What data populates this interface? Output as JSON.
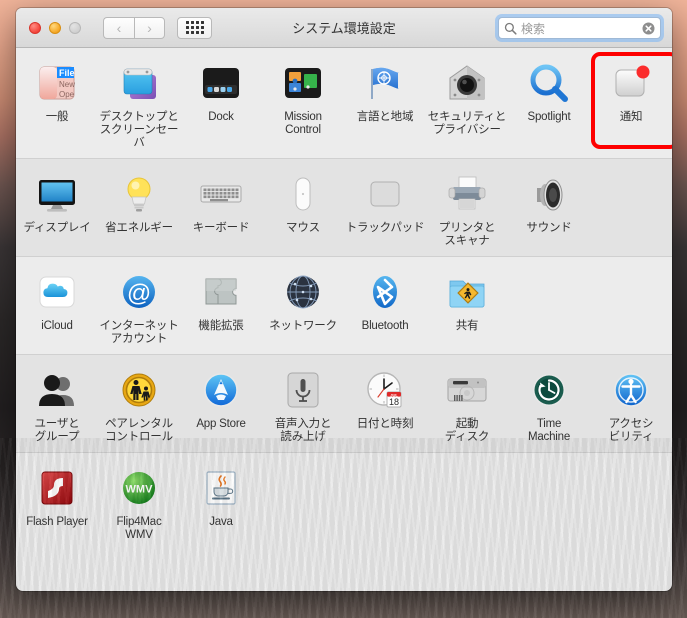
{
  "window": {
    "title": "システム環境設定",
    "traffic_lights": [
      "close",
      "minimize",
      "zoom"
    ],
    "nav": {
      "back": "‹",
      "forward": "›"
    },
    "grid_button": "show-all-grid-button"
  },
  "search": {
    "placeholder": "検索",
    "value": "検索",
    "icon": "search-icon",
    "clear_icon": "clear-icon"
  },
  "highlight": {
    "target": "通知",
    "color": "#fe0000"
  },
  "rows": [
    {
      "shade": "a",
      "items": [
        {
          "label": "一般",
          "icon": "general-icon"
        },
        {
          "label": "デスクトップと\nスクリーンセーバ",
          "icon": "desktop-screensaver-icon"
        },
        {
          "label": "Dock",
          "icon": "dock-icon"
        },
        {
          "label": "Mission\nControl",
          "icon": "mission-control-icon"
        },
        {
          "label": "言語と地域",
          "icon": "language-region-icon"
        },
        {
          "label": "セキュリティと\nプライバシー",
          "icon": "security-privacy-icon"
        },
        {
          "label": "Spotlight",
          "icon": "spotlight-icon"
        },
        {
          "label": "通知",
          "icon": "notifications-icon",
          "highlighted": true
        }
      ]
    },
    {
      "shade": "b",
      "items": [
        {
          "label": "ディスプレイ",
          "icon": "displays-icon"
        },
        {
          "label": "省エネルギー",
          "icon": "energy-saver-icon"
        },
        {
          "label": "キーボード",
          "icon": "keyboard-icon"
        },
        {
          "label": "マウス",
          "icon": "mouse-icon"
        },
        {
          "label": "トラックパッド",
          "icon": "trackpad-icon"
        },
        {
          "label": "プリンタと\nスキャナ",
          "icon": "printers-scanners-icon"
        },
        {
          "label": "サウンド",
          "icon": "sound-icon"
        }
      ]
    },
    {
      "shade": "a",
      "items": [
        {
          "label": "iCloud",
          "icon": "icloud-icon"
        },
        {
          "label": "インターネット\nアカウント",
          "icon": "internet-accounts-icon"
        },
        {
          "label": "機能拡張",
          "icon": "extensions-icon"
        },
        {
          "label": "ネットワーク",
          "icon": "network-icon"
        },
        {
          "label": "Bluetooth",
          "icon": "bluetooth-icon"
        },
        {
          "label": "共有",
          "icon": "sharing-icon"
        }
      ]
    },
    {
      "shade": "b",
      "items": [
        {
          "label": "ユーザと\nグループ",
          "icon": "users-groups-icon"
        },
        {
          "label": "ペアレンタル\nコントロール",
          "icon": "parental-controls-icon"
        },
        {
          "label": "App Store",
          "icon": "app-store-icon"
        },
        {
          "label": "音声入力と\n読み上げ",
          "icon": "dictation-speech-icon"
        },
        {
          "label": "日付と時刻",
          "icon": "date-time-icon"
        },
        {
          "label": "起動\nディスク",
          "icon": "startup-disk-icon"
        },
        {
          "label": "Time\nMachine",
          "icon": "time-machine-icon"
        },
        {
          "label": "アクセシ\nビリティ",
          "icon": "accessibility-icon"
        }
      ]
    },
    {
      "shade": "a",
      "items": [
        {
          "label": "Flash Player",
          "icon": "flash-player-icon"
        },
        {
          "label": "Flip4Mac\nWMV",
          "icon": "flip4mac-wmv-icon"
        },
        {
          "label": "Java",
          "icon": "java-icon"
        }
      ]
    }
  ]
}
